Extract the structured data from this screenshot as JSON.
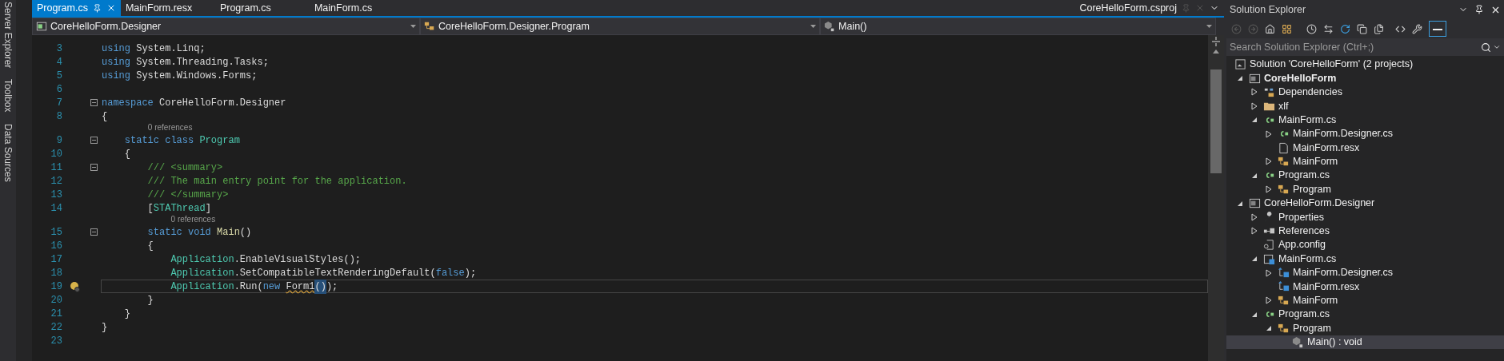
{
  "side_tabs": [
    {
      "label": "Server Explorer"
    },
    {
      "label": "Toolbox"
    },
    {
      "label": "Data Sources"
    }
  ],
  "tabs": [
    {
      "label": "Program.cs",
      "selected": true,
      "kind": "open"
    },
    {
      "label": "MainForm.resx",
      "selected": false,
      "kind": "open"
    },
    {
      "label": "Program.cs",
      "selected": false,
      "kind": "open"
    },
    {
      "label": "MainForm.cs",
      "selected": false,
      "kind": "open"
    },
    {
      "label": "CoreHelloForm.csproj",
      "selected": false,
      "kind": "preview"
    }
  ],
  "navigation": [
    {
      "label": "CoreHelloForm.Designer",
      "kind": "project"
    },
    {
      "label": "CoreHelloForm.Designer.Program",
      "kind": "class"
    },
    {
      "label": "Main()",
      "kind": "method"
    }
  ],
  "code_lines": [
    {
      "number": "3",
      "current": false,
      "lightbulb": false,
      "tokens": [
        {
          "text": "using",
          "kind": "keyword"
        },
        {
          "text": " System.Linq;",
          "kind": "plain"
        }
      ]
    },
    {
      "number": "4",
      "current": false,
      "lightbulb": false,
      "tokens": [
        {
          "text": "using",
          "kind": "keyword"
        },
        {
          "text": " System.Threading.Tasks;",
          "kind": "plain"
        }
      ]
    },
    {
      "number": "5",
      "current": false,
      "lightbulb": false,
      "tokens": [
        {
          "text": "using",
          "kind": "keyword"
        },
        {
          "text": " System.Windows.Forms;",
          "kind": "plain"
        }
      ]
    },
    {
      "number": "6",
      "current": false,
      "lightbulb": false
    },
    {
      "number": "7",
      "current": false,
      "lightbulb": false,
      "expanded": true,
      "tokens": [
        {
          "text": "namespace",
          "kind": "keyword"
        },
        {
          "text": " CoreHelloForm.Designer",
          "kind": "plain"
        }
      ]
    },
    {
      "number": "8",
      "current": false,
      "lightbulb": false,
      "tokens": [
        {
          "text": "{",
          "kind": "plain"
        }
      ]
    },
    {
      "number": "9",
      "current": false,
      "lightbulb": false,
      "expanded": true,
      "codelens": "0 references",
      "tokens": [
        {
          "text": "    static class",
          "kind": "keyword"
        },
        {
          "text": " Program",
          "kind": "type"
        }
      ]
    },
    {
      "number": "10",
      "current": false,
      "lightbulb": false,
      "tokens": [
        {
          "text": "    {",
          "kind": "plain"
        }
      ]
    },
    {
      "number": "11",
      "current": false,
      "lightbulb": false,
      "expanded": true,
      "tokens": [
        {
          "text": "        /// <summary>",
          "kind": "comment"
        }
      ]
    },
    {
      "number": "12",
      "current": false,
      "lightbulb": false,
      "tokens": [
        {
          "text": "        /// The main entry point for the application.",
          "kind": "comment"
        }
      ]
    },
    {
      "number": "13",
      "current": false,
      "lightbulb": false,
      "tokens": [
        {
          "text": "        /// </summary>",
          "kind": "comment"
        }
      ]
    },
    {
      "number": "14",
      "current": false,
      "lightbulb": false,
      "tokens": [
        {
          "text": "        [",
          "kind": "plain"
        },
        {
          "text": "STAThread",
          "kind": "type"
        },
        {
          "text": "]",
          "kind": "plain"
        }
      ]
    },
    {
      "number": "15",
      "current": false,
      "lightbulb": false,
      "expanded": true,
      "codelens": "0 references",
      "tokens": [
        {
          "text": "        static void",
          "kind": "keyword"
        },
        {
          "text": " Main",
          "kind": "method"
        },
        {
          "text": "()",
          "kind": "plain"
        }
      ]
    },
    {
      "number": "16",
      "current": false,
      "lightbulb": false,
      "tokens": [
        {
          "text": "        {",
          "kind": "plain"
        }
      ]
    },
    {
      "number": "17",
      "current": false,
      "lightbulb": false,
      "tokens": [
        {
          "text": "            Application",
          "kind": "type"
        },
        {
          "text": ".EnableVisualStyles();",
          "kind": "plain"
        }
      ]
    },
    {
      "number": "18",
      "current": false,
      "lightbulb": false,
      "tokens": [
        {
          "text": "            Application",
          "kind": "type"
        },
        {
          "text": ".SetCompatibleTextRenderingDefault(",
          "kind": "plain"
        },
        {
          "text": "false",
          "kind": "keyword"
        },
        {
          "text": ");",
          "kind": "plain"
        }
      ]
    },
    {
      "number": "19",
      "current": true,
      "lightbulb": true,
      "tokens": [
        {
          "text": "            Application",
          "kind": "type"
        },
        {
          "text": ".Run(",
          "kind": "plain"
        },
        {
          "text": "new ",
          "kind": "keyword"
        },
        {
          "text": "Form1",
          "kind": "error"
        },
        {
          "text": "()",
          "kind": "match"
        },
        {
          "text": ");",
          "kind": "plain"
        }
      ]
    },
    {
      "number": "20",
      "current": false,
      "lightbulb": false,
      "tokens": [
        {
          "text": "        }",
          "kind": "plain"
        }
      ]
    },
    {
      "number": "21",
      "current": false,
      "lightbulb": false,
      "tokens": [
        {
          "text": "    }",
          "kind": "plain"
        }
      ]
    },
    {
      "number": "22",
      "current": false,
      "lightbulb": false,
      "tokens": [
        {
          "text": "}",
          "kind": "plain"
        }
      ]
    },
    {
      "number": "23",
      "current": false,
      "lightbulb": false
    }
  ],
  "solution_explorer": {
    "title": "Solution Explorer",
    "search": {
      "placeholder": "Search Solution Explorer (Ctrl+;)"
    },
    "tree": {
      "label": "Solution 'CoreHelloForm' (2 projects)",
      "kind": "solution",
      "selected": false,
      "children": [
        {
          "label": "CoreHelloForm",
          "kind": "project",
          "startup": true,
          "expanded": true,
          "selected": false,
          "children": [
            {
              "label": "Dependencies",
              "kind": "dependencies",
              "expanded": false,
              "selected": false
            },
            {
              "label": "xlf",
              "kind": "folder",
              "expanded": false,
              "selected": false
            },
            {
              "label": "MainForm.cs",
              "kind": "csfile",
              "expanded": true,
              "selected": false,
              "children": [
                {
                  "label": "MainForm.Designer.cs",
                  "kind": "csfile",
                  "expanded": false,
                  "selected": false
                },
                {
                  "label": "MainForm.resx",
                  "kind": "resx",
                  "selected": false
                },
                {
                  "label": "MainForm",
                  "kind": "class",
                  "expanded": false,
                  "selected": false
                }
              ]
            },
            {
              "label": "Program.cs",
              "kind": "csfile",
              "expanded": true,
              "selected": false,
              "children": [
                {
                  "label": "Program",
                  "kind": "class",
                  "expanded": false,
                  "selected": false
                }
              ]
            }
          ]
        },
        {
          "label": "CoreHelloForm.Designer",
          "kind": "project",
          "startup": false,
          "expanded": true,
          "selected": false,
          "children": [
            {
              "label": "Properties",
              "kind": "properties",
              "expanded": false,
              "selected": false
            },
            {
              "label": "References",
              "kind": "references",
              "expanded": false,
              "selected": false
            },
            {
              "label": "App.config",
              "kind": "config",
              "selected": false
            },
            {
              "label": "MainForm.cs",
              "kind": "formfile",
              "expanded": true,
              "selected": false,
              "children": [
                {
                  "label": "MainForm.Designer.cs",
                  "kind": "designerfile",
                  "expanded": false,
                  "selected": false
                },
                {
                  "label": "MainForm.resx",
                  "kind": "designerfile",
                  "selected": false
                },
                {
                  "label": "MainForm",
                  "kind": "class",
                  "expanded": false,
                  "selected": false
                }
              ]
            },
            {
              "label": "Program.cs",
              "kind": "csfile",
              "expanded": true,
              "selected": false,
              "children": [
                {
                  "label": "Program",
                  "kind": "class",
                  "expanded": true,
                  "selected": false,
                  "children": [
                    {
                      "label": "Main() : void",
                      "kind": "method",
                      "selected": true
                    }
                  ]
                }
              ]
            }
          ]
        }
      ]
    }
  }
}
